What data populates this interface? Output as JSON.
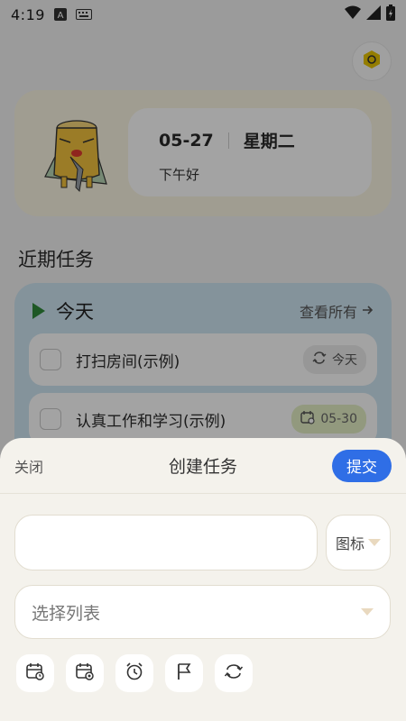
{
  "status_bar": {
    "time": "4:19"
  },
  "header": {
    "date": "05-27",
    "weekday": "星期二",
    "greeting": "下午好"
  },
  "recent": {
    "section_title": "近期任务",
    "panel_title": "今天",
    "view_all": "查看所有",
    "tasks": [
      {
        "label": "打扫房间(示例)",
        "tag": "今天"
      },
      {
        "label": "认真工作和学习(示例)",
        "tag": "05-30"
      }
    ]
  },
  "sheet": {
    "close_label": "关闭",
    "title": "创建任务",
    "submit_label": "提交",
    "task_input_value": "",
    "icon_label": "图标",
    "list_placeholder": "选择列表",
    "tools": [
      "start-date-icon",
      "due-date-icon",
      "alarm-icon",
      "flag-icon",
      "repeat-icon"
    ]
  },
  "colors": {
    "accent": "#2f6ee6",
    "panel": "#cfe6f3",
    "hero": "#fbf6e3",
    "sheet": "#f4f2ec"
  }
}
